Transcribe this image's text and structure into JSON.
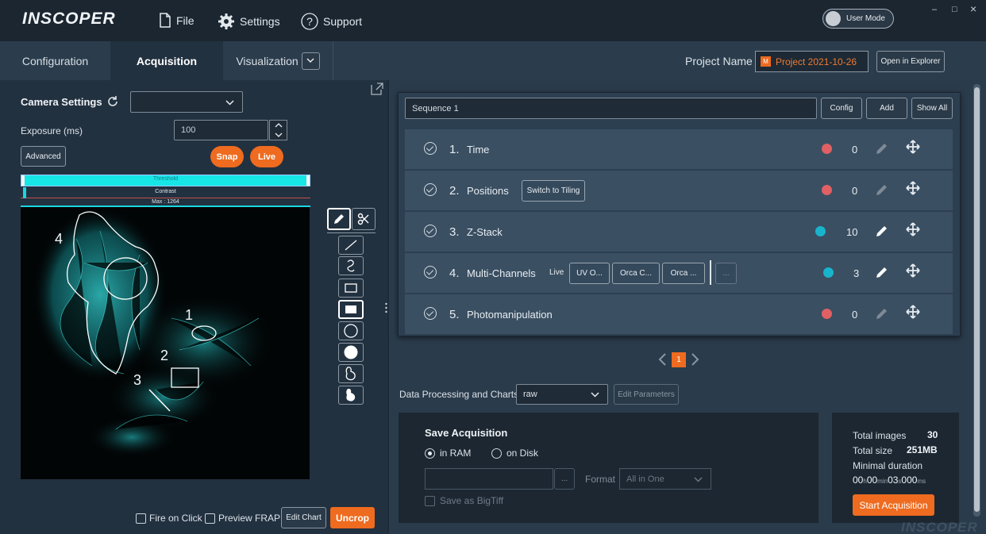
{
  "app": {
    "logo": "INSCOPER",
    "watermark": "INSCOPER"
  },
  "menu": {
    "file": "File",
    "settings": "Settings",
    "support": "Support"
  },
  "user_mode": {
    "label": "User Mode"
  },
  "window_controls": {
    "minimize": "–",
    "maximize": "□",
    "close": "×"
  },
  "tabs": [
    {
      "label": "Configuration"
    },
    {
      "label": "Acquisition",
      "active": true
    },
    {
      "label": "Visualization"
    }
  ],
  "project": {
    "label": "Project Name",
    "value": "Project 2021-10-26",
    "open_button": "Open in Explorer"
  },
  "camera": {
    "title": "Camera Settings",
    "exposure_label": "Exposure (ms)",
    "exposure_value": "100",
    "advanced": "Advanced",
    "snap": "Snap",
    "live": "Live",
    "threshold": "Threshold",
    "contrast": "Contrast",
    "max": "Max : 1264",
    "roi_labels": [
      "1",
      "2",
      "3",
      "4"
    ]
  },
  "bottom_controls": {
    "fire_on_click": "Fire on Click",
    "preview_frap": "Preview FRAP",
    "edit_chart": "Edit Chart",
    "uncrop": "Uncrop"
  },
  "sequence": {
    "name": "Sequence 1",
    "config": "Config",
    "add": "Add",
    "show_all": "Show All",
    "rows": [
      {
        "num": "1.",
        "label": "Time",
        "count": "0",
        "dot_color": "#e06064"
      },
      {
        "num": "2.",
        "label": "Positions",
        "count": "0",
        "dot_color": "#e06064",
        "extra_button": "Switch to Tiling"
      },
      {
        "num": "3.",
        "label": "Z-Stack",
        "count": "10",
        "dot_color": "#19b4cc"
      },
      {
        "num": "4.",
        "label": "Multi-Channels",
        "count": "3",
        "dot_color": "#19b4cc",
        "live": "Live",
        "channels": [
          "UV O...",
          "Orca C...",
          "Orca ..."
        ],
        "more": "..."
      },
      {
        "num": "5.",
        "label": "Photomanipulation",
        "count": "0",
        "dot_color": "#e06064"
      }
    ],
    "page": "1"
  },
  "processing": {
    "label": "Data Processing and Charts",
    "value": "raw",
    "edit_params": "Edit Parameters"
  },
  "save": {
    "title": "Save Acquisition",
    "in_ram": "in RAM",
    "on_disk": "on Disk",
    "path_button": "...",
    "format_label": "Format",
    "format_value": "All in One",
    "bigtiff": "Save as BigTiff"
  },
  "summary": {
    "total_images_label": "Total images",
    "total_images": "30",
    "total_size_label": "Total size",
    "total_size": "251MB",
    "min_duration_label": "Minimal duration",
    "duration": {
      "h": "00",
      "h_unit": "h",
      "min": "00",
      "min_unit": "min",
      "s": "03",
      "s_unit": "s",
      "ms": "000",
      "ms_unit": "ms"
    },
    "start": "Start Acquisition"
  }
}
